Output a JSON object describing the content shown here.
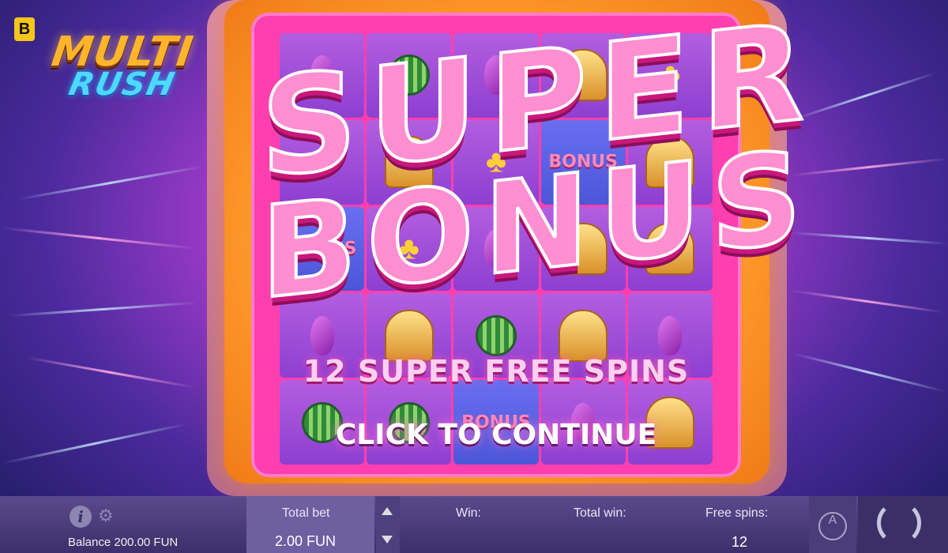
{
  "brand": {
    "badge": "B"
  },
  "logo": {
    "line1": "MULTI",
    "line2": "RUSH"
  },
  "overlay": {
    "title_line1": "SUPER",
    "title_line2": "BONUS",
    "subtitle": "12 SUPER FREE SPINS",
    "cta": "CLICK TO CONTINUE"
  },
  "reels": {
    "mini_bonus_label": "BONUS",
    "symbols": [
      [
        "eggplant",
        "watermelon",
        "eggplant",
        "bell",
        "clover"
      ],
      [
        "clover",
        "bell",
        "clover",
        "bonus",
        "bell"
      ],
      [
        "bonus",
        "clover",
        "eggplant",
        "bell",
        "bell"
      ],
      [
        "eggplant",
        "bell",
        "watermelon",
        "bell",
        "eggplant"
      ],
      [
        "watermelon",
        "watermelon",
        "bonus",
        "eggplant",
        "bell"
      ]
    ]
  },
  "bottom_bar": {
    "info_icon": "i",
    "gear_icon": "⚙",
    "balance": "Balance 200.00 FUN",
    "total_bet_label": "Total bet",
    "total_bet_value": "2.00 FUN",
    "win_label": "Win:",
    "total_win_label": "Total win:",
    "free_spins_label": "Free spins:",
    "free_spins_value": "12",
    "auto_label": "A"
  },
  "colors": {
    "accent_pink": "#ff3fb0",
    "frame_gold": "#ffb52a",
    "bar_bg": "#4d407e"
  }
}
